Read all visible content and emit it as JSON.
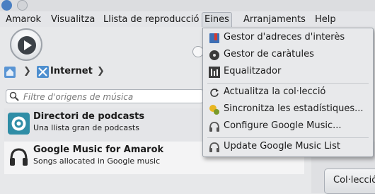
{
  "menubar": {
    "items": [
      {
        "label": "Amarok"
      },
      {
        "label": "Visualitza"
      },
      {
        "label": "Llista de reproducció"
      },
      {
        "label": "Eines"
      },
      {
        "label": "Arranjaments"
      },
      {
        "label": "Help"
      }
    ]
  },
  "breadcrumb": {
    "current": "Internet"
  },
  "search": {
    "placeholder": "Filtre d'origens de música"
  },
  "sources": [
    {
      "title": "Directori de podcasts",
      "subtitle": "Una llista gran de podcasts",
      "icon": "podcast-icon"
    },
    {
      "title": "Google Music for Amarok",
      "subtitle": "Songs allocated in Google music",
      "icon": "headphones-icon"
    }
  ],
  "right_tab": {
    "label": "Col·lecció"
  },
  "tools_menu": {
    "items": [
      {
        "label": "Gestor d'adreces d'interès",
        "icon": "bookmark-manager-icon"
      },
      {
        "label": "Gestor de caràtules",
        "icon": "cover-manager-icon"
      },
      {
        "label": "Equalitzador",
        "icon": "equalizer-icon"
      },
      {
        "label": "Actualitza la col·lecció",
        "icon": "refresh-icon"
      },
      {
        "label": "Sincronitza les estadístiques...",
        "icon": "sync-statistics-icon"
      },
      {
        "label": "Configure Google Music...",
        "icon": "headphones-icon"
      },
      {
        "label": "Update Google Music List",
        "icon": "headphones-icon"
      }
    ]
  }
}
